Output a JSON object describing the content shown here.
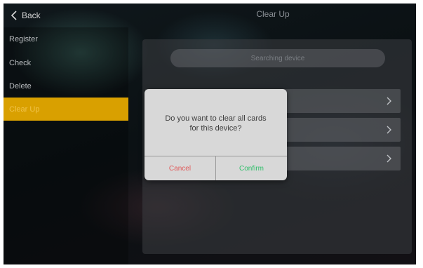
{
  "header": {
    "back_label": "Back",
    "title": "Clear Up"
  },
  "sidebar": {
    "items": [
      {
        "label": "Register",
        "active": false
      },
      {
        "label": "Check",
        "active": false
      },
      {
        "label": "Delete",
        "active": false
      },
      {
        "label": "Clear Up",
        "active": true
      }
    ]
  },
  "panel": {
    "search_text": "Searching device"
  },
  "dialog": {
    "message_line1": "Do you want to clear all cards",
    "message_line2": "for this device?",
    "cancel_label": "Cancel",
    "confirm_label": "Confirm"
  },
  "colors": {
    "accent": "#d9a000",
    "cancel": "#e05a5a",
    "confirm": "#2fbf6a"
  },
  "icons": {
    "back": "chevron-left-icon",
    "row": "chevron-right-icon"
  }
}
